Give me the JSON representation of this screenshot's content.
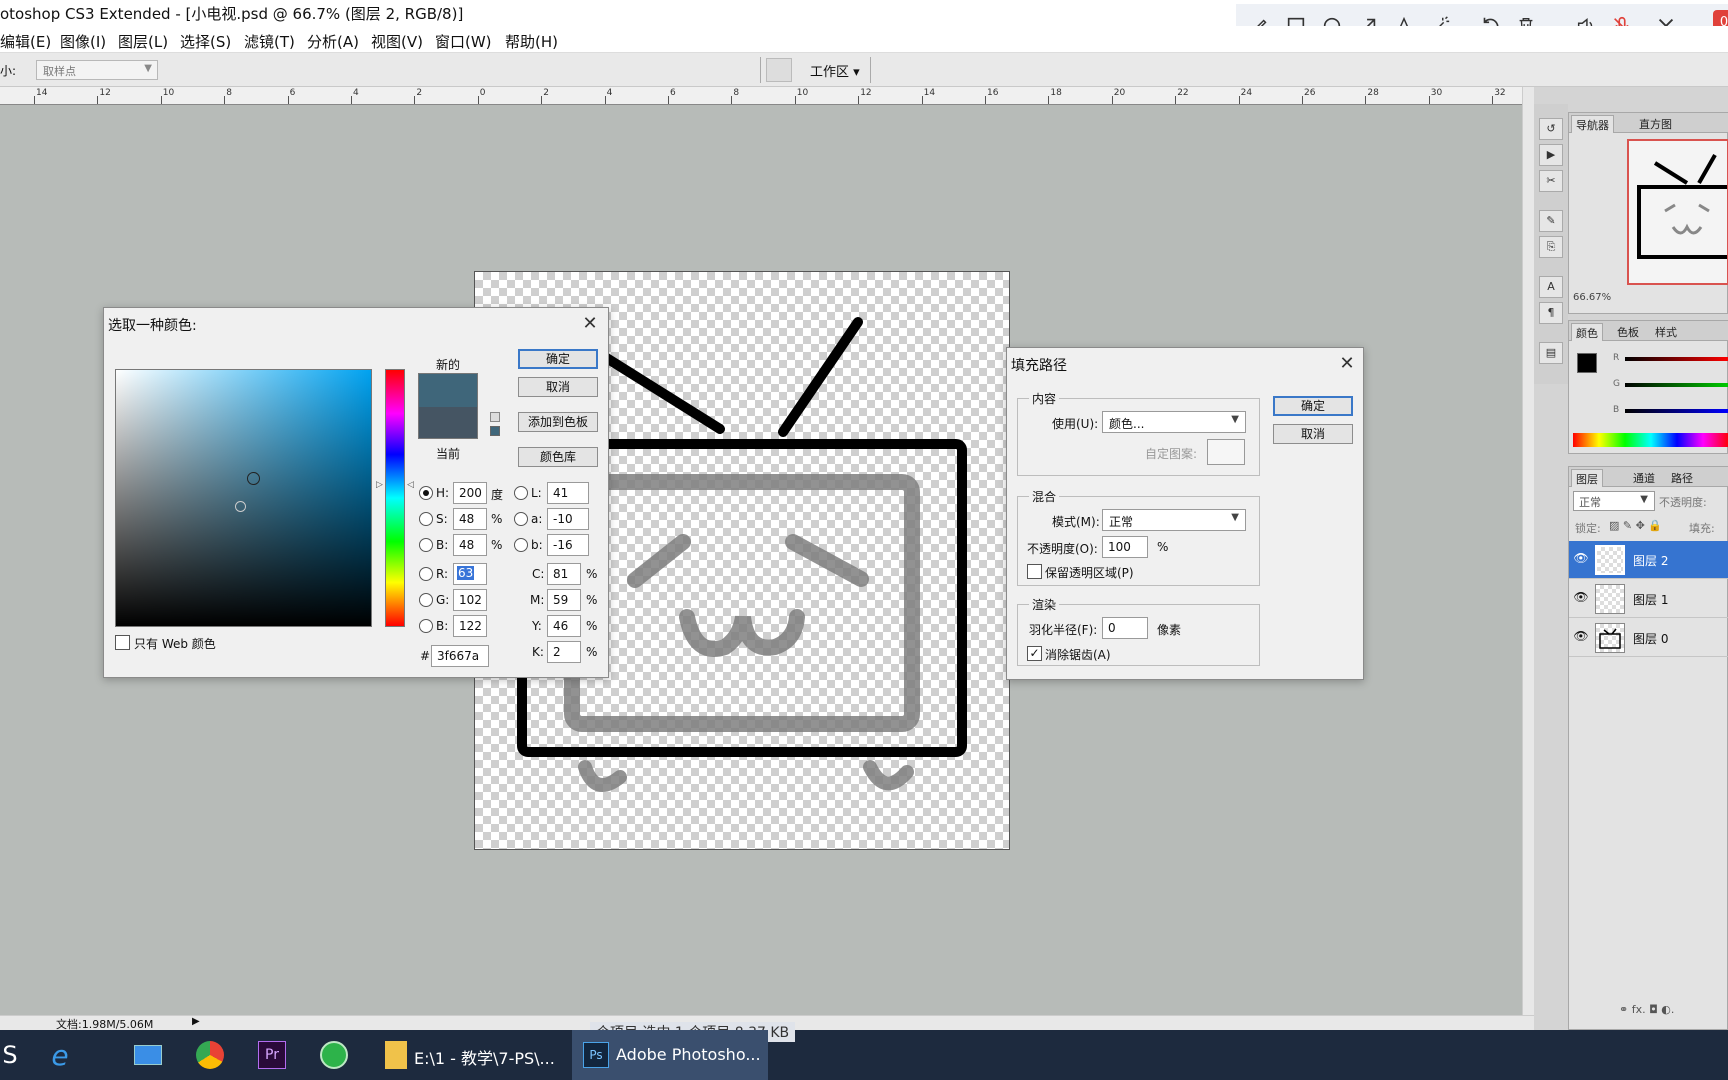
{
  "window": {
    "title": "otoshop CS3 Extended - [小电视.psd @ 66.7% (图层 2, RGB/8)]"
  },
  "menu": [
    "编辑(E)",
    "图像(I)",
    "图层(L)",
    "选择(S)",
    "滤镜(T)",
    "分析(A)",
    "视图(V)",
    "窗口(W)",
    "帮助(H)"
  ],
  "annotation_toolbar": {
    "icons": [
      "pencil-icon",
      "rectangle-icon",
      "circle-icon",
      "arrow-icon",
      "text-icon",
      "magic-wand-icon",
      "undo-icon",
      "trash-icon",
      "speaker-icon",
      "mic-muted-icon",
      "close-icon"
    ],
    "badge": "0"
  },
  "options_bar": {
    "size_label": "小:",
    "sample_value": "取样点",
    "workspace": "工作区 ▾"
  },
  "ruler": {
    "ticks": [
      "14",
      "12",
      "10",
      "8",
      "6",
      "4",
      "2",
      "0",
      "2",
      "4",
      "6",
      "8",
      "10",
      "12",
      "14",
      "16",
      "18",
      "20",
      "22",
      "24",
      "26",
      "28",
      "30",
      "32"
    ]
  },
  "color_picker": {
    "title": "选取一种颜色:",
    "new_label": "新的",
    "current_label": "当前",
    "new_color": "#3f667a",
    "current_color": "#455563",
    "buttons": {
      "ok": "确定",
      "cancel": "取消",
      "add_swatch": "添加到色板",
      "library": "颜色库"
    },
    "web_only": "只有 Web 颜色",
    "fields": {
      "H": {
        "label": "H:",
        "value": "200",
        "unit": "度"
      },
      "S": {
        "label": "S:",
        "value": "48",
        "unit": "%"
      },
      "B": {
        "label": "B:",
        "value": "48",
        "unit": "%"
      },
      "R": {
        "label": "R:",
        "value": "63"
      },
      "G": {
        "label": "G:",
        "value": "102"
      },
      "Bl": {
        "label": "B:",
        "value": "122"
      },
      "L": {
        "label": "L:",
        "value": "41"
      },
      "a": {
        "label": "a:",
        "value": "-10"
      },
      "b": {
        "label": "b:",
        "value": "-16"
      },
      "C": {
        "label": "C:",
        "value": "81",
        "unit": "%"
      },
      "M": {
        "label": "M:",
        "value": "59",
        "unit": "%"
      },
      "Y": {
        "label": "Y:",
        "value": "46",
        "unit": "%"
      },
      "K": {
        "label": "K:",
        "value": "2",
        "unit": "%"
      },
      "hex_label": "#",
      "hex": "3f667a"
    }
  },
  "fill_path": {
    "title": "填充路径",
    "content_group": "内容",
    "use_label": "使用(U):",
    "use_value": "颜色...",
    "custom_pattern_label": "自定图案:",
    "blend_group": "混合",
    "mode_label": "模式(M):",
    "mode_value": "正常",
    "opacity_label": "不透明度(O):",
    "opacity_value": "100",
    "opacity_unit": "%",
    "preserve_label": "保留透明区域(P)",
    "render_group": "渲染",
    "feather_label": "羽化半径(F):",
    "feather_value": "0",
    "feather_unit": "像素",
    "antialias_label": "消除锯齿(A)",
    "ok": "确定",
    "cancel": "取消"
  },
  "navigator": {
    "tabs": [
      "导航器",
      "直方图"
    ],
    "zoom": "66.67%"
  },
  "color_panel": {
    "tabs": [
      "颜色",
      "色板",
      "样式"
    ],
    "channels": [
      "R",
      "G",
      "B"
    ]
  },
  "layers_panel": {
    "tabs": [
      "图层",
      "通道",
      "路径"
    ],
    "blend_mode": "正常",
    "opacity_label": "不透明度:",
    "lock_label": "锁定:",
    "fill_label": "填充:",
    "layers": [
      {
        "name": "图层 2",
        "selected": true
      },
      {
        "name": "图层 1",
        "selected": false
      },
      {
        "name": "图层 0",
        "selected": false
      }
    ]
  },
  "status": {
    "doc": "文档:1.98M/5.06M",
    "overlay_text": "个项目   选中 1 个项目 8.37 KB"
  },
  "taskbar": {
    "explorer_label": "E:\\1 - 教学\\7-PS\\...",
    "photoshop_label": "Adobe Photosho..."
  }
}
